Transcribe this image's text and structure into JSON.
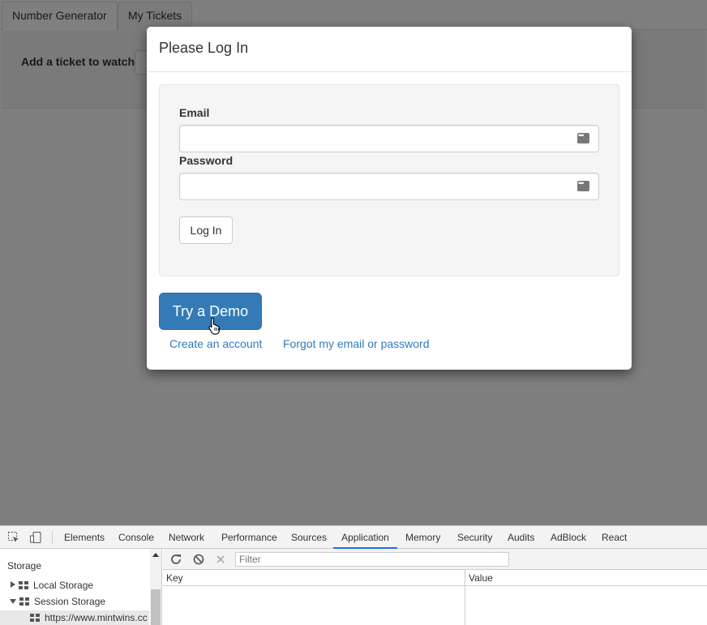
{
  "app": {
    "tabs": [
      {
        "label": "Number Generator"
      },
      {
        "label": "My Tickets"
      }
    ],
    "watch_label": "Add a ticket to watch"
  },
  "modal": {
    "title": "Please Log In",
    "email_label": "Email",
    "email_value": "",
    "password_label": "Password",
    "password_value": "",
    "login_button": "Log In",
    "demo_button": "Try a Demo",
    "create_link": "Create an account",
    "forgot_link": "Forgot my email or password"
  },
  "devtools": {
    "tabs": [
      {
        "label": "Elements"
      },
      {
        "label": "Console"
      },
      {
        "label": "Network"
      },
      {
        "label": "Performance"
      },
      {
        "label": "Sources"
      },
      {
        "label": "Application"
      },
      {
        "label": "Memory"
      },
      {
        "label": "Security"
      },
      {
        "label": "Audits"
      },
      {
        "label": "AdBlock"
      },
      {
        "label": "React"
      }
    ],
    "active_tab": "Application",
    "sidebar": {
      "title": "Storage",
      "items": [
        {
          "label": "Local Storage"
        },
        {
          "label": "Session Storage"
        },
        {
          "label": "https://www.mintwins.cc"
        }
      ]
    },
    "filter_placeholder": "Filter",
    "columns": {
      "key": "Key",
      "value": "Value"
    }
  },
  "colors": {
    "primary": "#337ab7",
    "overlay": "rgba(0,0,0,0.5)",
    "devtools_accent": "#1a73e8"
  }
}
